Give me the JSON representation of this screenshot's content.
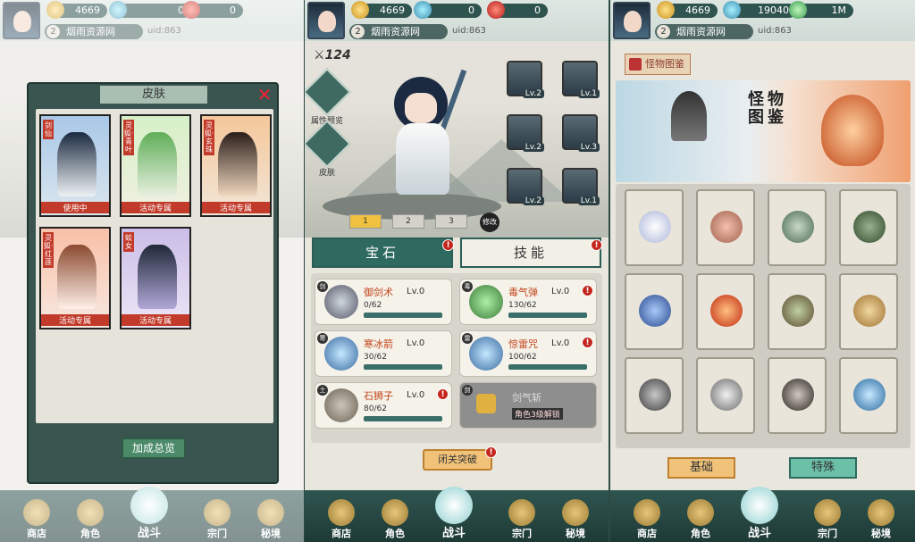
{
  "screen1": {
    "currency": {
      "gold": "4669",
      "gem": "0",
      "ruby": "0"
    },
    "player": {
      "level": "2",
      "name": "烟雨资源网",
      "uid": "uid:863"
    },
    "dialog": {
      "title": "皮肤",
      "skins": [
        {
          "name": "剑仙",
          "status": "使用中"
        },
        {
          "name": "灵狐·青叶",
          "status": "活动专属"
        },
        {
          "name": "灵狐·玄珠",
          "status": "活动专属"
        },
        {
          "name": "灵狐·红莲",
          "status": "活动专属"
        },
        {
          "name": "蛟女",
          "status": "活动专属"
        }
      ],
      "button": "加成总览"
    }
  },
  "screen2": {
    "currency": {
      "gold": "4669",
      "gem": "0",
      "ruby": "0"
    },
    "player": {
      "level": "2",
      "name": "烟雨资源网",
      "uid": "uid:863"
    },
    "power": "124",
    "side": {
      "attr": "属性预览",
      "skin": "皮肤"
    },
    "gems": [
      "Lv.2",
      "Lv.1",
      "Lv.2",
      "Lv.3",
      "Lv.2",
      "Lv.1"
    ],
    "pages": [
      "1",
      "2",
      "3"
    ],
    "change_label": "修改",
    "tabs": {
      "gem": "宝石",
      "skill": "技能"
    },
    "skills": [
      {
        "tag": "剑",
        "name": "御剑术",
        "level": "Lv.0",
        "progress": "0/62"
      },
      {
        "tag": "毒",
        "name": "毒气弹",
        "level": "Lv.0",
        "progress": "130/62"
      },
      {
        "tag": "寒",
        "name": "寒冰箭",
        "level": "Lv.0",
        "progress": "30/62"
      },
      {
        "tag": "雷",
        "name": "惊雷咒",
        "level": "Lv.0",
        "progress": "100/62"
      },
      {
        "tag": "土",
        "name": "石狮子",
        "level": "Lv.0",
        "progress": "80/62"
      },
      {
        "tag": "剑",
        "name": "剑气斩",
        "level": "",
        "progress": "角色3级解锁"
      }
    ],
    "close_button": "闭关突破"
  },
  "screen3": {
    "currency": {
      "gold": "4669",
      "jade": "19040",
      "leaf": "1M"
    },
    "player": {
      "level": "2",
      "name": "烟雨资源网",
      "uid": "uid:863"
    },
    "book_tab": "怪物图鉴",
    "banner_title": "怪物图鉴",
    "buttons": {
      "basic": "基础",
      "special": "特殊"
    }
  },
  "nav": {
    "shop": "商店",
    "role": "角色",
    "battle": "战斗",
    "sect": "宗门",
    "realm": "秘境"
  },
  "colors": {
    "accent": "#2f6a60",
    "alert": "#c4261d",
    "highlight": "#f0c27a"
  }
}
